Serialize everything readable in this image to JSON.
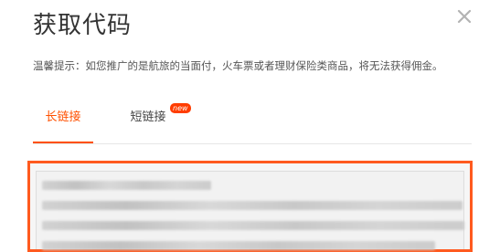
{
  "dialog": {
    "title": "获取代码",
    "tip": "温馨提示：如您推广的是航旅的当面付，火车票或者理财保险类商品，将无法获得佣金。",
    "close_icon": "close-icon"
  },
  "tabs": [
    {
      "label": "长链接",
      "active": true
    },
    {
      "label": "短链接",
      "badge": "new",
      "active": false
    }
  ],
  "colors": {
    "accent": "#ff5000",
    "badge": "#ff3d00",
    "code_border": "#ff5a1f"
  }
}
